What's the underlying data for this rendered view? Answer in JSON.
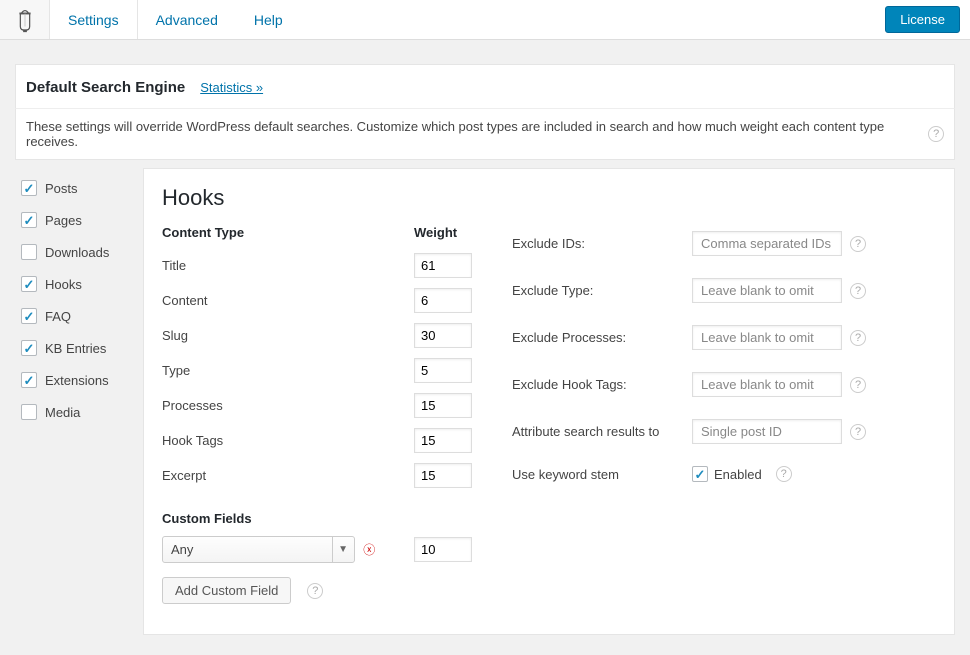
{
  "topbar": {
    "tabs": [
      "Settings",
      "Advanced",
      "Help"
    ],
    "active_tab": 0,
    "license_label": "License"
  },
  "title": {
    "heading": "Default Search Engine",
    "stats_link": "Statistics »"
  },
  "description": "These settings will override WordPress default searches. Customize which post types are included in search and how much weight each content type receives.",
  "sidebar": [
    {
      "label": "Posts",
      "checked": true
    },
    {
      "label": "Pages",
      "checked": true
    },
    {
      "label": "Downloads",
      "checked": false
    },
    {
      "label": "Hooks",
      "checked": true
    },
    {
      "label": "FAQ",
      "checked": true
    },
    {
      "label": "KB Entries",
      "checked": true
    },
    {
      "label": "Extensions",
      "checked": true
    },
    {
      "label": "Media",
      "checked": false
    }
  ],
  "section_title": "Hooks",
  "headers": {
    "content_type": "Content Type",
    "weight": "Weight"
  },
  "weights": [
    {
      "label": "Title",
      "value": "61"
    },
    {
      "label": "Content",
      "value": "6"
    },
    {
      "label": "Slug",
      "value": "30"
    },
    {
      "label": "Type",
      "value": "5"
    },
    {
      "label": "Processes",
      "value": "15"
    },
    {
      "label": "Hook Tags",
      "value": "15"
    },
    {
      "label": "Excerpt",
      "value": "15"
    }
  ],
  "custom_fields": {
    "heading": "Custom Fields",
    "select_value": "Any",
    "weight": "10",
    "add_label": "Add Custom Field"
  },
  "right": {
    "exclude_ids": {
      "label": "Exclude IDs:",
      "placeholder": "Comma separated IDs"
    },
    "exclude_type": {
      "label": "Exclude Type:",
      "placeholder": "Leave blank to omit"
    },
    "exclude_processes": {
      "label": "Exclude Processes:",
      "placeholder": "Leave blank to omit"
    },
    "exclude_hook_tags": {
      "label": "Exclude Hook Tags:",
      "placeholder": "Leave blank to omit"
    },
    "attribute": {
      "label": "Attribute search results to",
      "placeholder": "Single post ID"
    },
    "stem": {
      "label": "Use keyword stem",
      "enabled_label": "Enabled",
      "checked": true
    }
  }
}
